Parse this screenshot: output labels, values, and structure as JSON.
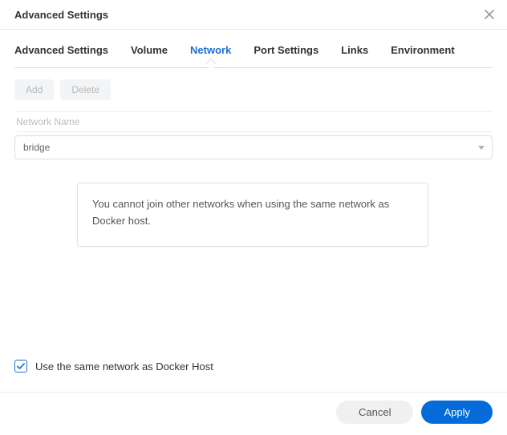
{
  "window": {
    "title": "Advanced Settings"
  },
  "tabs": {
    "advanced": "Advanced Settings",
    "volume": "Volume",
    "network": "Network",
    "port": "Port Settings",
    "links": "Links",
    "env": "Environment"
  },
  "toolbar": {
    "add": "Add",
    "delete": "Delete"
  },
  "table": {
    "col_network_name": "Network Name",
    "selected_network": "bridge"
  },
  "tooltip": {
    "message": "You cannot join other networks when using the same network as Docker host."
  },
  "checkbox": {
    "same_network_label": "Use the same network as Docker Host"
  },
  "footer": {
    "cancel": "Cancel",
    "apply": "Apply"
  }
}
